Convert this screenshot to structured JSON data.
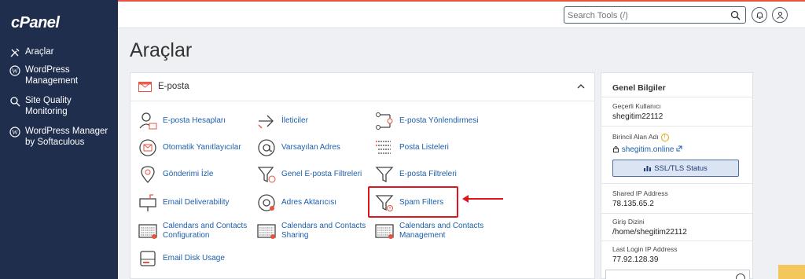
{
  "app": {
    "logo": "cPanel"
  },
  "sidebar": {
    "items": [
      {
        "label": "Araçlar",
        "icon": "tools-icon"
      },
      {
        "label": "WordPress Management",
        "icon": "wordpress-icon"
      },
      {
        "label": "Site Quality Monitoring",
        "icon": "magnifier-icon"
      },
      {
        "label": "WordPress Manager by Softaculous",
        "icon": "wordpress-icon"
      }
    ]
  },
  "header": {
    "search_placeholder": "Search Tools (/)"
  },
  "page": {
    "title": "Araçlar"
  },
  "email_panel": {
    "title": "E-posta",
    "tools": [
      {
        "label": "E-posta Hesapları",
        "icon": "email-accounts-icon"
      },
      {
        "label": "İleticiler",
        "icon": "forwarders-icon"
      },
      {
        "label": "E-posta Yönlendirmesi",
        "icon": "email-routing-icon"
      },
      {
        "label": "Otomatik Yanıtlayıcılar",
        "icon": "autoresponder-icon"
      },
      {
        "label": "Varsayılan Adres",
        "icon": "at-sign-icon"
      },
      {
        "label": "Posta Listeleri",
        "icon": "mailing-list-icon"
      },
      {
        "label": "Gönderimi İzle",
        "icon": "track-delivery-icon"
      },
      {
        "label": "Genel E-posta Filtreleri",
        "icon": "global-filter-icon"
      },
      {
        "label": "E-posta Filtreleri",
        "icon": "filter-icon"
      },
      {
        "label": "Email Deliverability",
        "icon": "mailbox-icon"
      },
      {
        "label": "Adres Aktarıcısı",
        "icon": "address-importer-icon"
      },
      {
        "label": "Spam Filters",
        "icon": "spam-filter-icon"
      },
      {
        "label": "Calendars and Contacts Configuration",
        "icon": "calendar-config-icon"
      },
      {
        "label": "Calendars and Contacts Sharing",
        "icon": "calendar-share-icon"
      },
      {
        "label": "Calendars and Contacts Management",
        "icon": "calendar-manage-icon"
      },
      {
        "label": "Email Disk Usage",
        "icon": "disk-usage-icon"
      }
    ]
  },
  "info_panel": {
    "title": "Genel Bilgiler",
    "current_user_label": "Geçerli Kullanıcı",
    "current_user": "shegitim22112",
    "primary_domain_label": "Birincil Alan Adı",
    "primary_domain": "shegitim.online",
    "ssl_button": "SSL/TLS Status",
    "shared_ip_label": "Shared IP Address",
    "shared_ip": "78.135.65.2",
    "home_dir_label": "Giriş Dizini",
    "home_dir": "/home/shegitim22112",
    "last_login_label": "Last Login IP Address",
    "last_login": "77.92.128.39"
  },
  "colors": {
    "sidebar": "#1f2e4d",
    "link": "#1d5fa8",
    "accent": "#e8533f",
    "highlight": "#e0161f"
  }
}
